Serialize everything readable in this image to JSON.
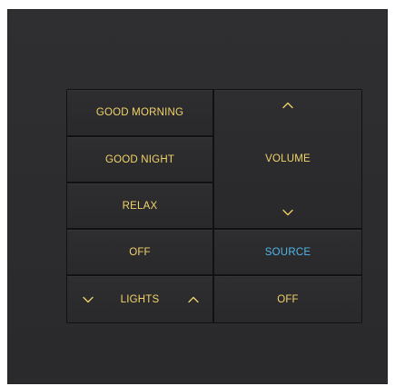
{
  "keypad": {
    "left_column": {
      "good_morning": "GOOD MORNING",
      "good_night": "GOOD NIGHT",
      "relax": "RELAX",
      "off": "OFF",
      "lights": "LIGHTS"
    },
    "right_column": {
      "volume": "VOLUME",
      "source": "SOURCE",
      "off": "OFF"
    }
  },
  "icons": {
    "volume_up": "chevron-up-icon",
    "volume_down": "chevron-down-icon",
    "lights_down": "chevron-down-icon",
    "lights_up": "chevron-up-icon"
  },
  "colors": {
    "plate": "#2d2d2f",
    "key": "#2b2b2d",
    "label_amber": "#f2d36a",
    "label_blue": "#4fb8ea"
  }
}
